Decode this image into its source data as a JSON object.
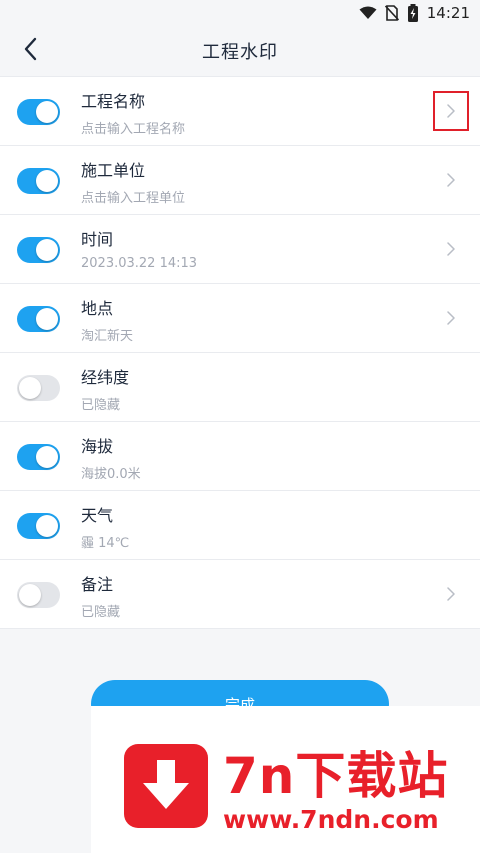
{
  "status_bar": {
    "time": "14:21"
  },
  "header": {
    "title": "工程水印",
    "back_icon": "chevron-left-icon"
  },
  "rows": [
    {
      "title": "工程名称",
      "subtitle": "点击输入工程名称",
      "enabled": true,
      "has_chevron": true,
      "highlighted": true
    },
    {
      "title": "施工单位",
      "subtitle": "点击输入工程单位",
      "enabled": true,
      "has_chevron": true
    },
    {
      "title": "时间",
      "subtitle": "2023.03.22 14:13",
      "enabled": true,
      "has_chevron": true
    },
    {
      "title": "地点",
      "subtitle": "淘汇新天",
      "enabled": true,
      "has_chevron": true
    },
    {
      "title": "经纬度",
      "subtitle": "已隐藏",
      "enabled": false,
      "has_chevron": false
    },
    {
      "title": "海拔",
      "subtitle": "海拔0.0米",
      "enabled": true,
      "has_chevron": false
    },
    {
      "title": "天气",
      "subtitle": "霾 14℃",
      "enabled": true,
      "has_chevron": false
    },
    {
      "title": "备注",
      "subtitle": "已隐藏",
      "enabled": false,
      "has_chevron": true
    }
  ],
  "done_button": {
    "label": "完成"
  },
  "watermark": {
    "name": "7n下载站",
    "url": "www.7ndn.com"
  },
  "colors": {
    "accent": "#1ea2f0",
    "toggle_off": "#e3e5e9",
    "highlight": "#e0202a",
    "watermark": "#e8202a"
  }
}
